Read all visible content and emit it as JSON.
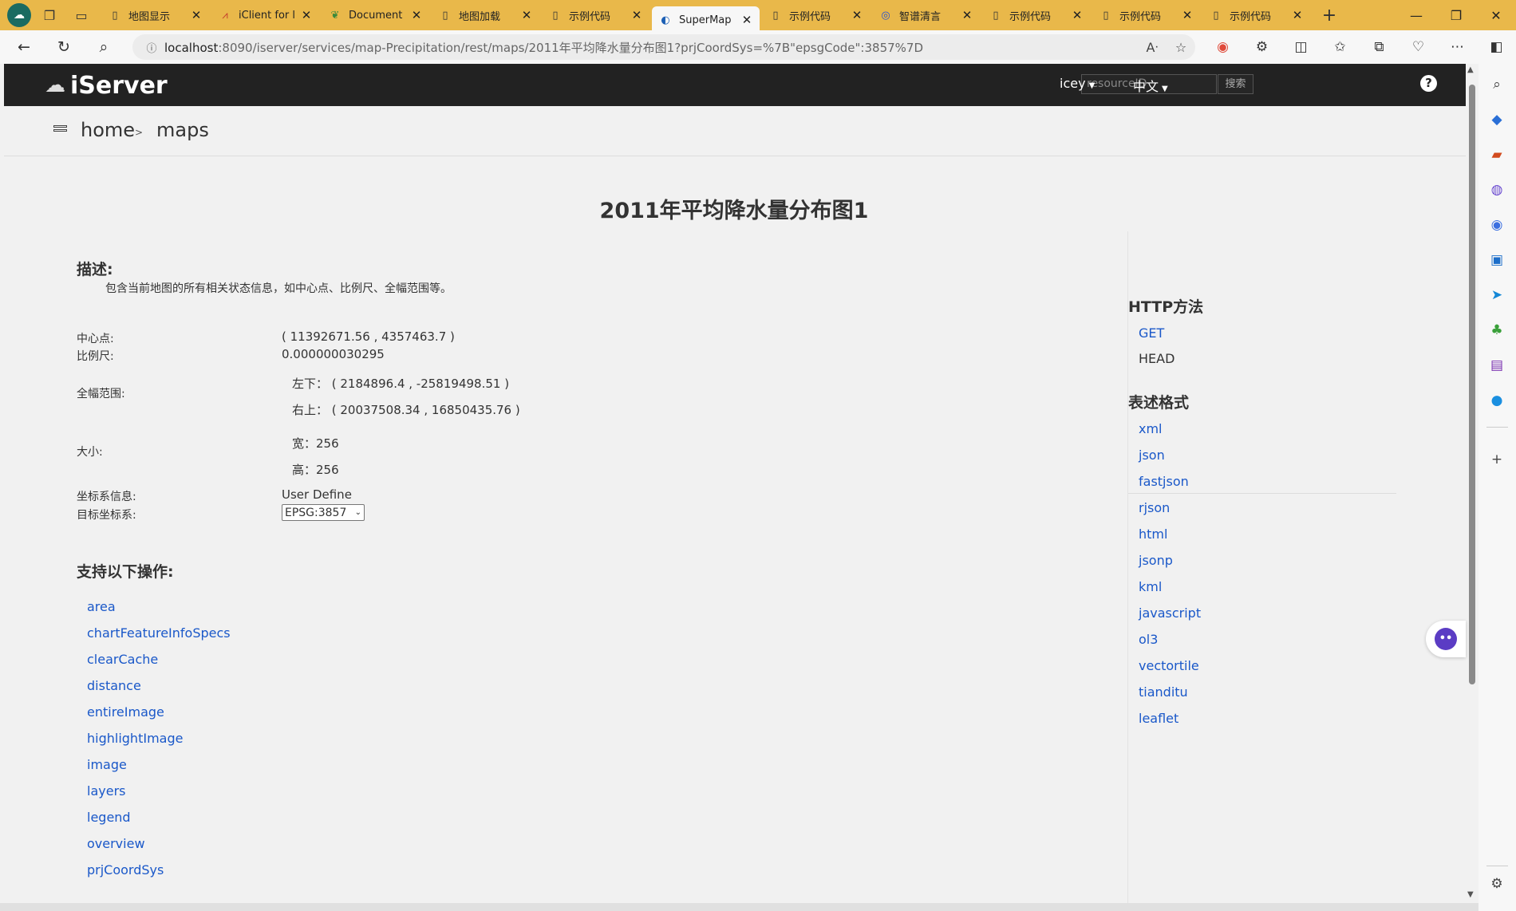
{
  "browser": {
    "tabs": [
      {
        "icon": "page-icon",
        "title": "地图显示",
        "active": false
      },
      {
        "icon": "iclient-icon",
        "title": "iClient for l",
        "active": false
      },
      {
        "icon": "leaf-icon",
        "title": "Document",
        "active": false
      },
      {
        "icon": "page-icon",
        "title": "地图加载",
        "active": false
      },
      {
        "icon": "page-icon",
        "title": "示例代码",
        "active": false
      },
      {
        "icon": "supermap-icon",
        "title": "SuperMap",
        "active": true
      },
      {
        "icon": "page-icon",
        "title": "示例代码",
        "active": false
      },
      {
        "icon": "zhipu-icon",
        "title": "智谱清言",
        "active": false
      },
      {
        "icon": "page-icon",
        "title": "示例代码",
        "active": false
      },
      {
        "icon": "page-icon",
        "title": "示例代码",
        "active": false
      },
      {
        "icon": "page-icon",
        "title": "示例代码",
        "active": false
      }
    ],
    "url_host": "localhost",
    "url_path": ":8090/iserver/services/map-Precipitation/rest/maps/2011年平均降水量分布图1?prjCoordSys=%7B\"epsgCode\":3857%7D"
  },
  "header": {
    "logo_text": "iServer",
    "search_placeholder": "resourceID",
    "search_button": "搜索",
    "user": "icey",
    "language": "中文",
    "help": "?"
  },
  "breadcrumb": {
    "home": "home",
    "sep": ">",
    "current": "maps"
  },
  "main": {
    "title": "2011年平均降水量分布图1",
    "desc_heading": "描述:",
    "desc_text": "包含当前地图的所有相关状态信息，如中心点、比例尺、全幅范围等。",
    "center_label": "中心点:",
    "center_value": "( 11392671.56 , 4357463.7 )",
    "scale_label": "比例尺:",
    "scale_value": "0.000000030295",
    "bounds_label": "全幅范围:",
    "bounds_ll": "左下：  ( 2184896.4 , -25819498.51 )",
    "bounds_ur": "右上：  ( 20037508.34 , 16850435.76 )",
    "size_label": "大小:",
    "size_width": "宽：256",
    "size_height": "高：256",
    "coord_label": "坐标系信息:",
    "coord_value": "User Define",
    "target_label": "目标坐标系:",
    "target_value": "EPSG:3857",
    "ops_heading": "支持以下操作:",
    "operations": [
      "area",
      "chartFeatureInfoSpecs",
      "clearCache",
      "distance",
      "entireImage",
      "highlightImage",
      "image",
      "layers",
      "legend",
      "overview",
      "prjCoordSys"
    ]
  },
  "sidebar": {
    "http_heading": "HTTP方法",
    "methods": [
      "GET",
      "HEAD"
    ],
    "format_heading": "表述格式",
    "formats": [
      "xml",
      "json",
      "fastjson",
      "rjson",
      "html",
      "jsonp",
      "kml",
      "javascript",
      "ol3",
      "vectortile",
      "tianditu",
      "leaflet"
    ]
  },
  "colors": {
    "tabstrip": "#e9b84a",
    "navbar": "#222222",
    "link": "#1a58c9"
  }
}
